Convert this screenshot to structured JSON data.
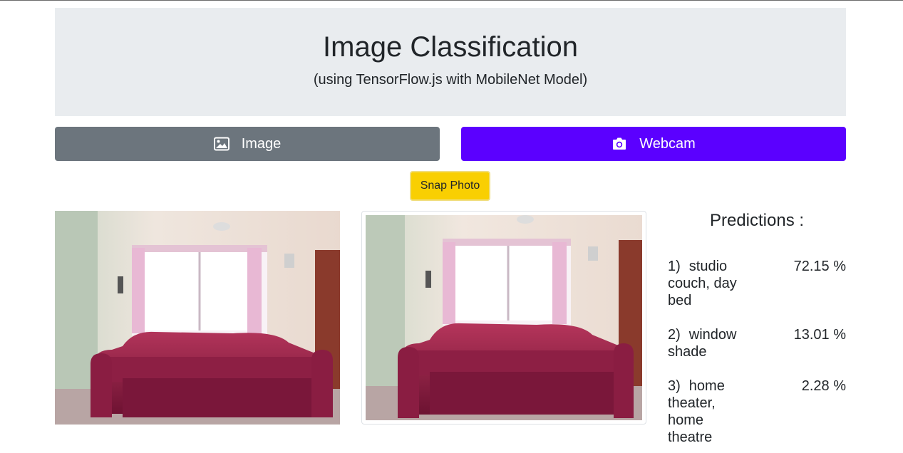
{
  "header": {
    "title": "Image Classification",
    "subtitle": "(using TensorFlow.js with MobileNet Model)"
  },
  "buttons": {
    "image_label": "Image",
    "image_icon": "image-icon",
    "webcam_label": "Webcam",
    "webcam_icon": "camera-icon",
    "snap_label": "Snap Photo"
  },
  "colors": {
    "image_button": "#6c757d",
    "webcam_button": "#5b00ff",
    "snap_button": "#f9cf02",
    "header_bg": "#e9ecef"
  },
  "predictions": {
    "title": "Predictions :",
    "items": [
      {
        "rank": "1)",
        "label": "studio couch, day bed",
        "percent": "72.15 %"
      },
      {
        "rank": "2)",
        "label": "window shade",
        "percent": "13.01 %"
      },
      {
        "rank": "3)",
        "label": "home theater, home theatre",
        "percent": "2.28 %"
      }
    ]
  }
}
